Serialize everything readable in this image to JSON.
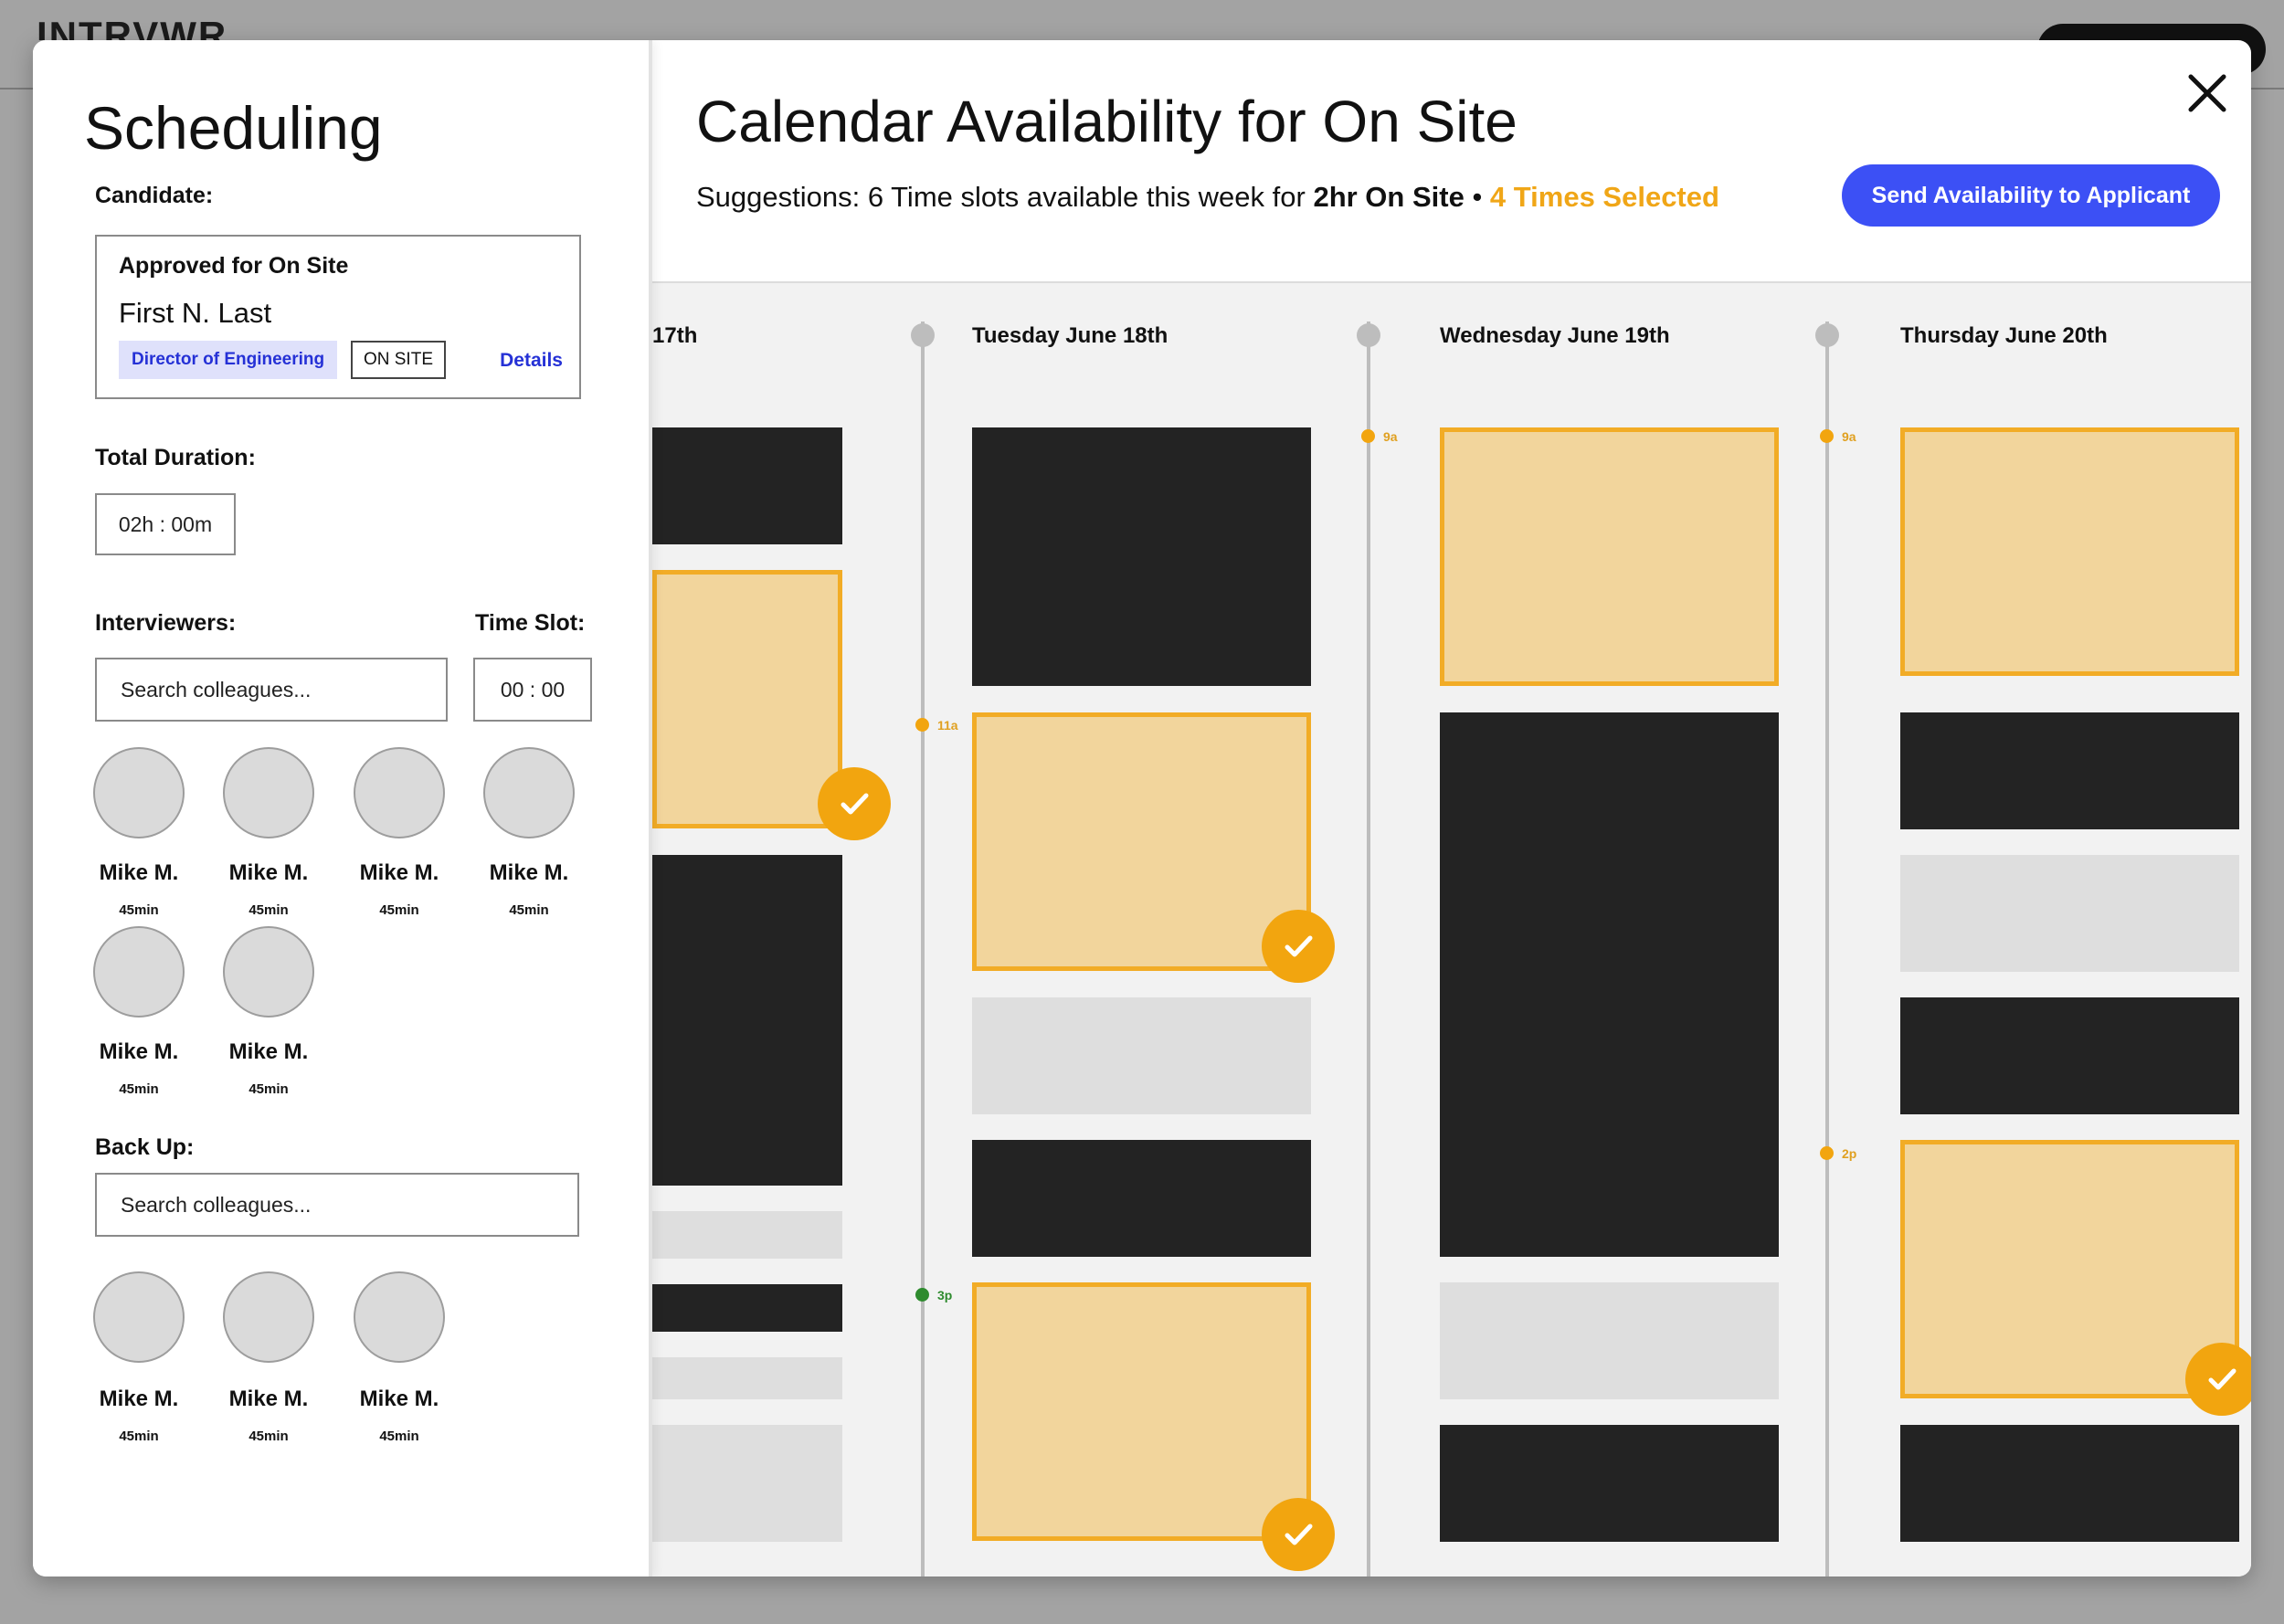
{
  "app_logo": "INTRVWR",
  "sidebar": {
    "title": "Scheduling",
    "candidate_label": "Candidate:",
    "candidate": {
      "status": "Approved for On Site",
      "name": "First N. Last",
      "role": "Director of Engineering",
      "stage_tag": "ON SITE",
      "details_link": "Details"
    },
    "duration_label": "Total Duration:",
    "duration_value": "02h : 00m",
    "interviewers_label": "Interviewers:",
    "timeslot_label": "Time Slot:",
    "interviewer_search_placeholder": "Search colleagues...",
    "timeslot_value": "00 : 00",
    "interviewers": [
      {
        "name": "Mike M.",
        "duration": "45min"
      },
      {
        "name": "Mike M.",
        "duration": "45min"
      },
      {
        "name": "Mike M.",
        "duration": "45min"
      },
      {
        "name": "Mike M.",
        "duration": "45min"
      },
      {
        "name": "Mike M.",
        "duration": "45min"
      },
      {
        "name": "Mike M.",
        "duration": "45min"
      }
    ],
    "backup_label": "Back Up:",
    "backup_search_placeholder": "Search colleagues...",
    "backups": [
      {
        "name": "Mike M.",
        "duration": "45min"
      },
      {
        "name": "Mike M.",
        "duration": "45min"
      },
      {
        "name": "Mike M.",
        "duration": "45min"
      }
    ]
  },
  "main": {
    "title": "Calendar Availability for On Site",
    "suggestion_prefix": "Suggestions: 6 Time slots available this week for ",
    "suggestion_bold": "2hr On Site",
    "separator": " • ",
    "selected_text": "4 Times Selected",
    "send_button": "Send Availability to Applicant"
  },
  "calendar": {
    "days": [
      {
        "label": "17th"
      },
      {
        "label": "Tuesday June 18th"
      },
      {
        "label": "Wednesday June 19th"
      },
      {
        "label": "Thursday June 20th"
      }
    ],
    "time_markers": [
      {
        "label": "11a"
      },
      {
        "label": "3p"
      },
      {
        "label": "9a"
      },
      {
        "label": "9a"
      },
      {
        "label": "2p"
      }
    ]
  },
  "colors": {
    "accent_blue": "#3c50f5",
    "selected_orange": "#f2ac26",
    "selected_fill": "#f2d59c",
    "busy": "#232323",
    "free": "#dedede",
    "marker_green": "#2e8b2e"
  }
}
